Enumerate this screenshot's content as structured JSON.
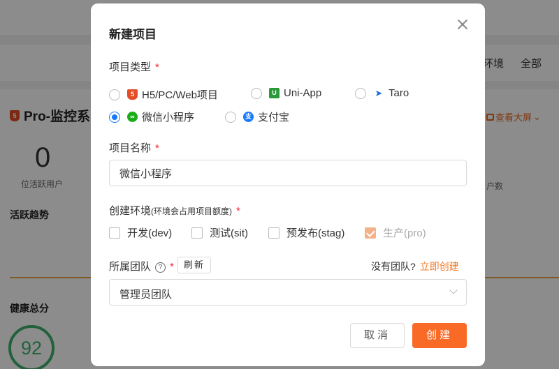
{
  "background": {
    "filter_env_label": "环境",
    "filter_all_label": "全部",
    "project_title": "Pro-监控系",
    "active_users_count": "0",
    "active_users_label": "位活跃用户",
    "view_big_screen": "查看大屏",
    "right_col_label": "户数",
    "active_trend_label": "活跃趋势",
    "health_total_label": "健康总分",
    "health_score": "92"
  },
  "dialog": {
    "title": "新建项目",
    "project_type": {
      "label": "项目类型",
      "required_mark": "*",
      "options": [
        {
          "label": "H5/PC/Web项目",
          "icon": "html5-icon",
          "selected": false
        },
        {
          "label": "Uni-App",
          "icon": "uni-app-icon",
          "selected": false
        },
        {
          "label": "Taro",
          "icon": "taro-icon",
          "selected": false
        },
        {
          "label": "微信小程序",
          "icon": "wechat-miniprogram-icon",
          "selected": true
        },
        {
          "label": "支付宝",
          "icon": "alipay-icon",
          "selected": false
        }
      ]
    },
    "project_name": {
      "label": "项目名称",
      "required_mark": "*",
      "value": "微信小程序"
    },
    "environment": {
      "label": "创建环境",
      "label_note": "(环境会占用项目额度)",
      "required_mark": "*",
      "options": [
        {
          "label": "开发(dev)",
          "checked": false,
          "disabled": false
        },
        {
          "label": "测试(sit)",
          "checked": false,
          "disabled": false
        },
        {
          "label": "预发布(stag)",
          "checked": false,
          "disabled": false
        },
        {
          "label": "生产(pro)",
          "checked": true,
          "disabled": true
        }
      ]
    },
    "team": {
      "label": "所属团队",
      "required_mark": "*",
      "help_icon": "question-circle-icon",
      "refresh_label": "刷新",
      "no_team_text": "没有团队?",
      "create_now_link": "立即创建",
      "selected_value": "管理员团队"
    },
    "buttons": {
      "cancel": "取消",
      "create": "创建"
    }
  },
  "colors": {
    "primary_orange": "#fa6a27",
    "radio_blue": "#1677ff",
    "required_red": "#f5222d",
    "health_green": "#3fb16e"
  }
}
